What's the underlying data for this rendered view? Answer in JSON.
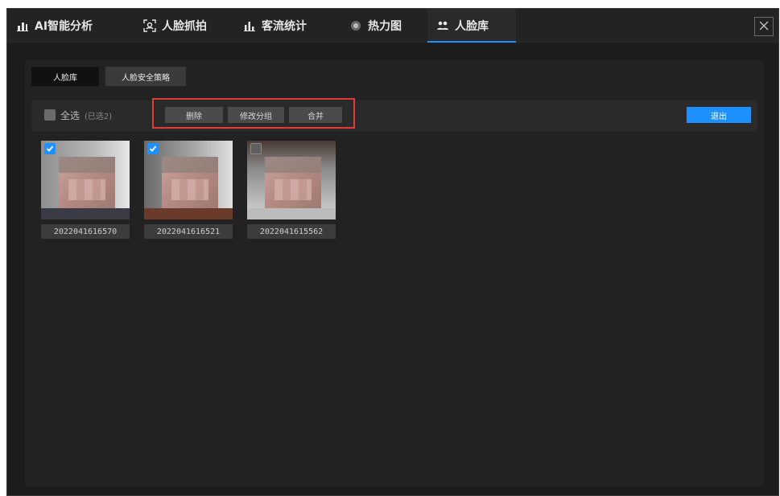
{
  "tabs": [
    {
      "label": "AI智能分析",
      "icon": "chart-icon",
      "active": false
    },
    {
      "label": "人脸抓拍",
      "icon": "face-scan-icon",
      "active": false
    },
    {
      "label": "客流统计",
      "icon": "bar-chart-icon",
      "active": false
    },
    {
      "label": "热力图",
      "icon": "heatmap-icon",
      "active": false
    },
    {
      "label": "人脸库",
      "icon": "people-icon",
      "active": true
    }
  ],
  "close_icon": "close-icon",
  "subtabs": [
    {
      "label": "人脸库",
      "active": true
    },
    {
      "label": "人脸安全策略",
      "active": false
    }
  ],
  "toolbar": {
    "select_all_label": "全选",
    "selected_count_label": "(已选2)",
    "delete_label": "删除",
    "change_group_label": "修改分组",
    "merge_label": "合并",
    "exit_label": "退出"
  },
  "faces": [
    {
      "caption": "2022041616570",
      "checked": true
    },
    {
      "caption": "2022041616521",
      "checked": true
    },
    {
      "caption": "2022041615562",
      "checked": false
    }
  ],
  "colors": {
    "accent": "#1e90ff",
    "highlight_box": "#e23a3a",
    "background": "#1c1c1c"
  }
}
